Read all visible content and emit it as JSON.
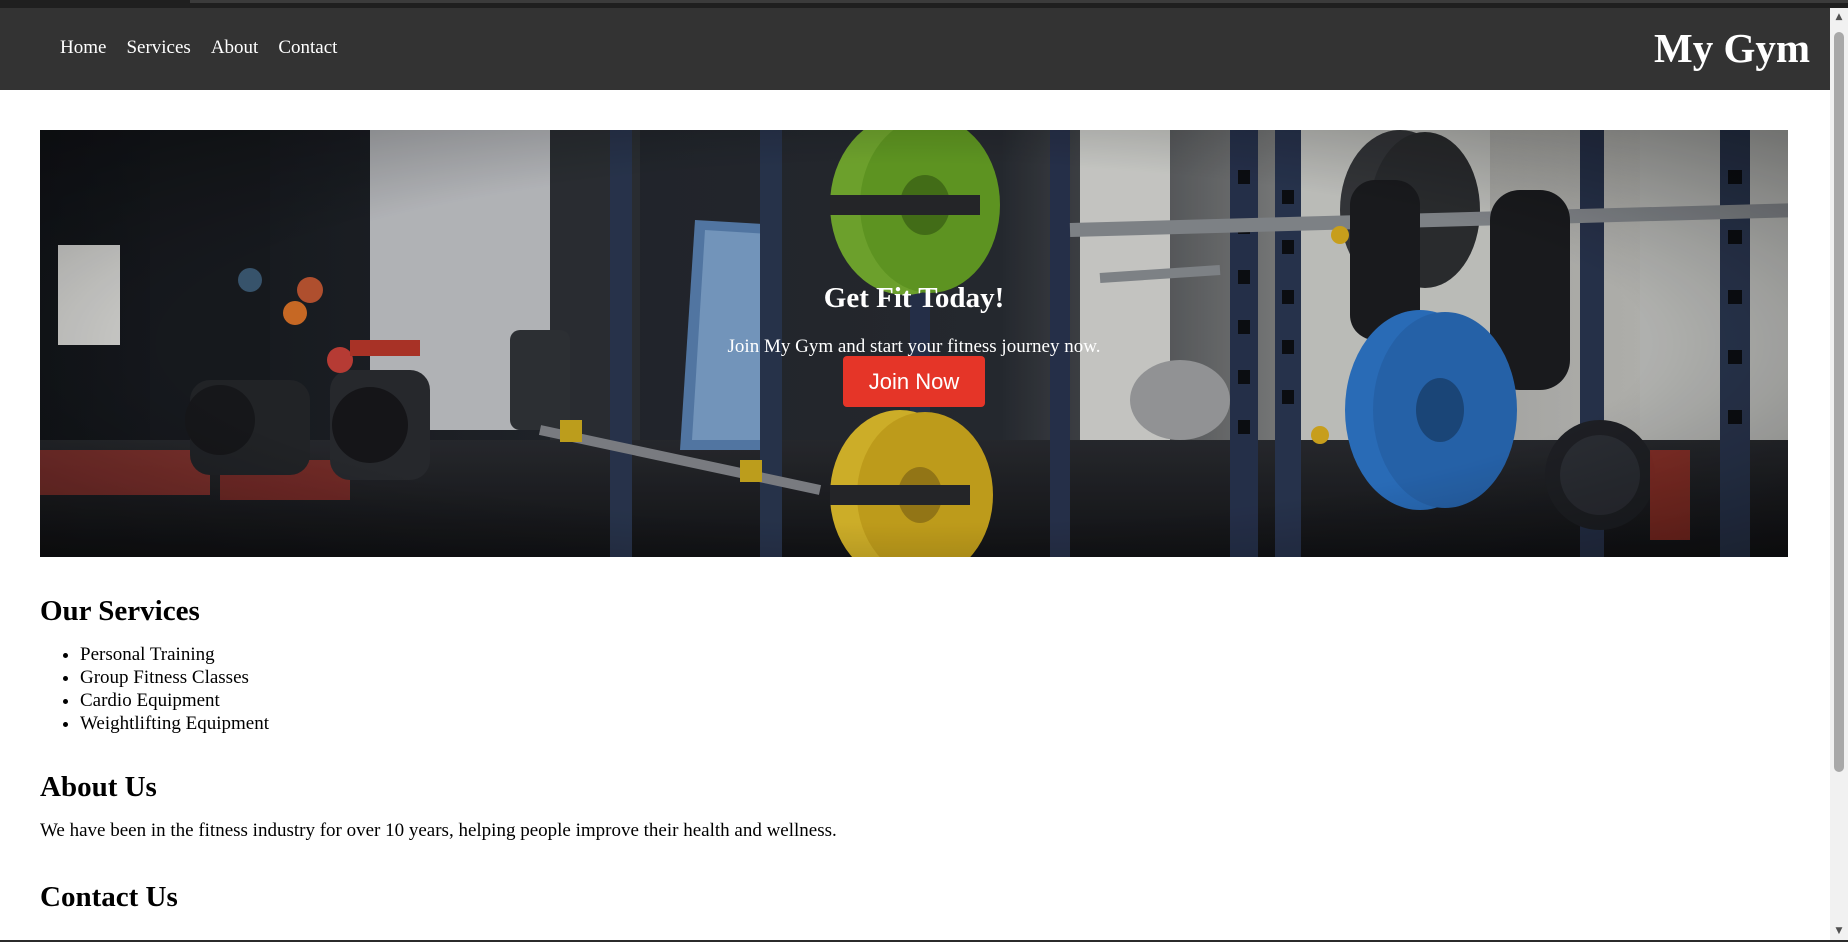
{
  "header": {
    "nav": [
      {
        "label": "Home"
      },
      {
        "label": "Services"
      },
      {
        "label": "About"
      },
      {
        "label": "Contact"
      }
    ],
    "logo": "My Gym",
    "background": "#333333"
  },
  "hero": {
    "title": "Get Fit Today!",
    "subtitle": "Join My Gym and start your fitness journey now.",
    "button_label": "Join Now",
    "button_color": "#e53528",
    "image": "gym-interior-photo"
  },
  "services": {
    "heading": "Our Services",
    "items": [
      "Personal Training",
      "Group Fitness Classes",
      "Cardio Equipment",
      "Weightlifting Equipment"
    ]
  },
  "about": {
    "heading": "About Us",
    "text": "We have been in the fitness industry for over 10 years, helping people improve their health and wellness."
  },
  "contact": {
    "heading": "Contact Us"
  },
  "scrollbar": {
    "up_icon": "scroll-up-arrow",
    "down_icon": "scroll-down-arrow"
  }
}
